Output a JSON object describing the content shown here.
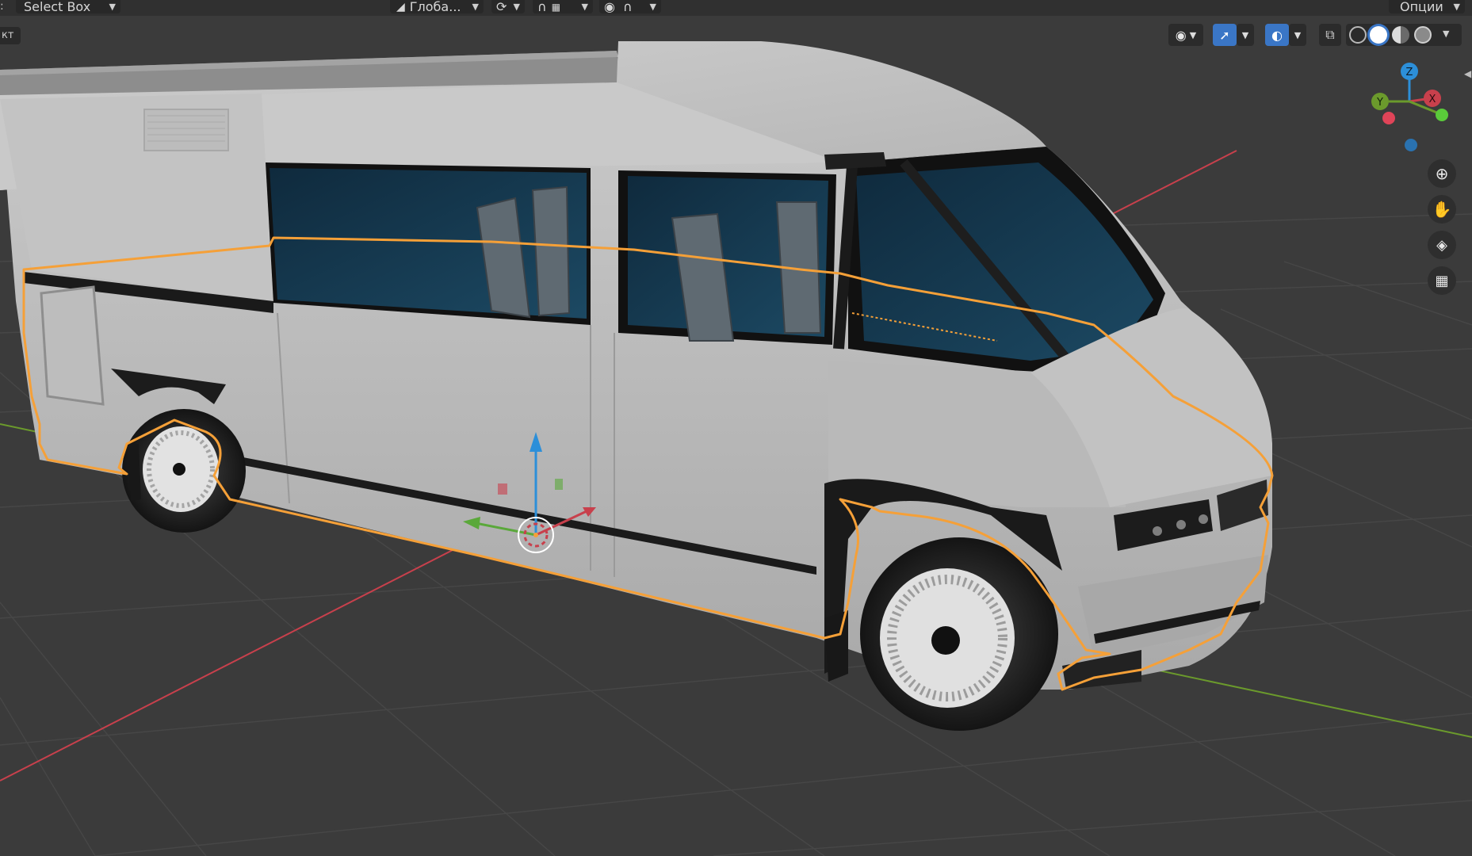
{
  "header": {
    "select_mode": "Select Box",
    "orientation": "Глоба...",
    "options": "Опции"
  },
  "viewport": {
    "mode_tab": "кт",
    "gizmo_axes": {
      "x": "X",
      "y": "Y",
      "z": "Z"
    }
  },
  "tools": {
    "visibility_icon": "eye-icon",
    "gizmo_icon": "gizmo-icon",
    "overlay_icon": "overlay-icon",
    "xray_icon": "xray-icon",
    "shading": [
      "wireframe",
      "solid",
      "material",
      "rendered"
    ],
    "shading_active": "solid",
    "nav": [
      "zoom-icon",
      "hand-icon",
      "camera-icon",
      "grid-view-icon"
    ]
  },
  "colors": {
    "background": "#3b3b3b",
    "selection_outline": "#f5a038",
    "axis_x": "#c8404c",
    "axis_y": "#6b9a2c",
    "axis_z": "#2c8fd9",
    "active_blue": "#3a76c6"
  }
}
